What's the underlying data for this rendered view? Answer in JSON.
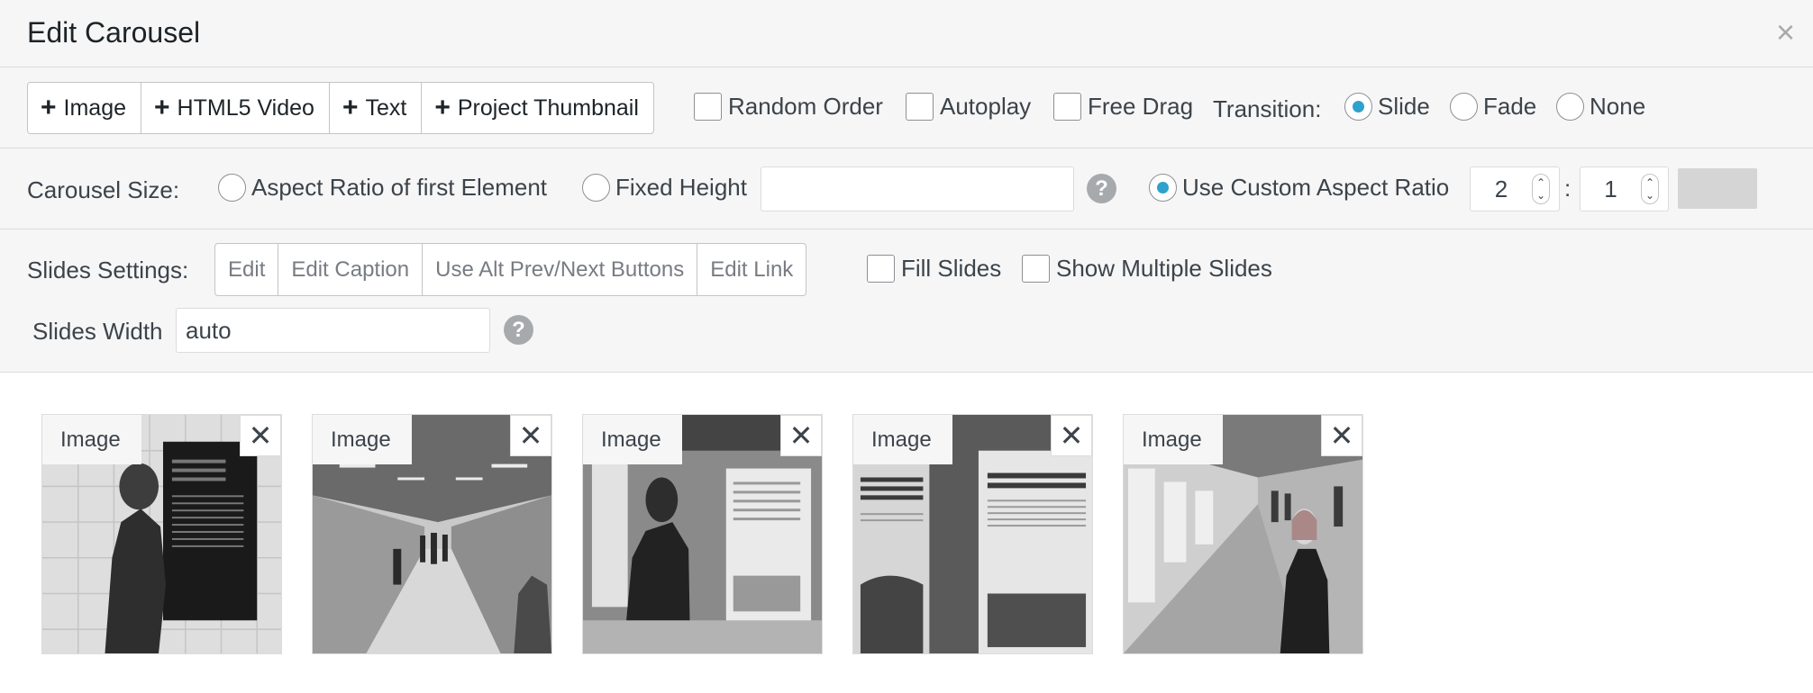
{
  "title": "Edit Carousel",
  "close_icon": "×",
  "add_buttons": [
    {
      "label": "Image"
    },
    {
      "label": "HTML5 Video"
    },
    {
      "label": "Text"
    },
    {
      "label": "Project Thumbnail"
    }
  ],
  "options": {
    "random_order": {
      "label": "Random Order",
      "checked": false
    },
    "autoplay": {
      "label": "Autoplay",
      "checked": false
    },
    "free_drag": {
      "label": "Free Drag",
      "checked": false
    }
  },
  "transition": {
    "label": "Transition:",
    "options": [
      "Slide",
      "Fade",
      "None"
    ],
    "selected": "Slide"
  },
  "carousel_size": {
    "label": "Carousel Size:",
    "options": [
      "Aspect Ratio of first Element",
      "Fixed Height",
      "Use Custom Aspect Ratio"
    ],
    "selected": "Use Custom Aspect Ratio",
    "fixed_height_value": "",
    "ratio_width": "2",
    "ratio_separator": ":",
    "ratio_height": "1",
    "help_glyph": "?"
  },
  "slides_settings": {
    "label": "Slides Settings:",
    "buttons": [
      "Edit",
      "Edit Caption",
      "Use Alt Prev/Next Buttons",
      "Edit Link"
    ],
    "fill_slides": {
      "label": "Fill Slides",
      "checked": false
    },
    "show_multiple": {
      "label": "Show Multiple Slides",
      "checked": false
    },
    "width_label": "Slides Width",
    "width_value": "auto"
  },
  "slides": [
    {
      "type_label": "Image",
      "remove_icon": "✕"
    },
    {
      "type_label": "Image",
      "remove_icon": "✕"
    },
    {
      "type_label": "Image",
      "remove_icon": "✕"
    },
    {
      "type_label": "Image",
      "remove_icon": "✕"
    },
    {
      "type_label": "Image",
      "remove_icon": "✕"
    }
  ],
  "colors": {
    "accent": "#2ea2cc",
    "panel_bg": "#f6f6f6",
    "border": "#dcdcde"
  }
}
